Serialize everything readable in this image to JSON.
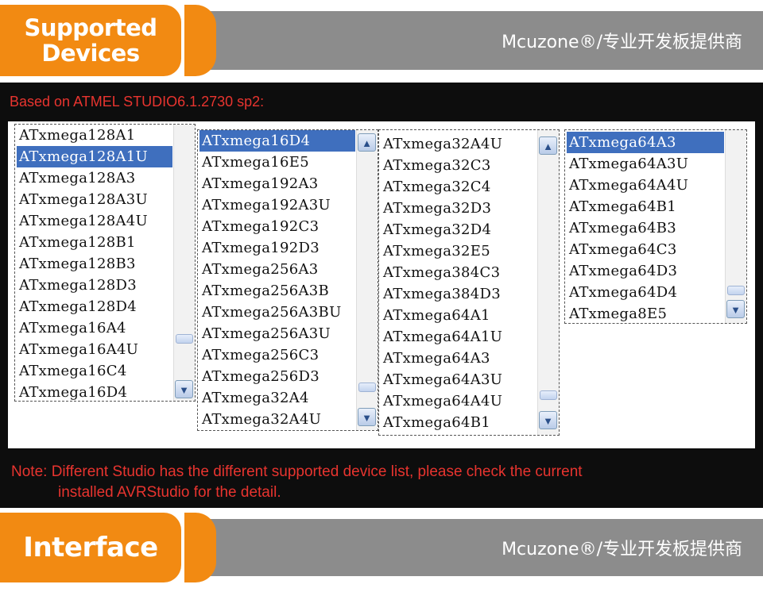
{
  "header_top": {
    "title": "Supported\nDevices",
    "brand": "Mcuzone®/专业开发板提供商"
  },
  "based_on": "Based on ATMEL STUDIO6.1.2730 sp2:",
  "lists": [
    {
      "items": [
        "ATxmega128A1",
        "ATxmega128A1U",
        "ATxmega128A3",
        "ATxmega128A3U",
        "ATxmega128A4U",
        "ATxmega128B1",
        "ATxmega128B3",
        "ATxmega128D3",
        "ATxmega128D4",
        "ATxmega16A4",
        "ATxmega16A4U",
        "ATxmega16C4",
        "ATxmega16D4"
      ],
      "selected": "ATxmega128A1U"
    },
    {
      "items": [
        "ATxmega16D4",
        "ATxmega16E5",
        "ATxmega192A3",
        "ATxmega192A3U",
        "ATxmega192C3",
        "ATxmega192D3",
        "ATxmega256A3",
        "ATxmega256A3B",
        "ATxmega256A3BU",
        "ATxmega256A3U",
        "ATxmega256C3",
        "ATxmega256D3",
        "ATxmega32A4",
        "ATxmega32A4U"
      ],
      "selected": "ATxmega16D4"
    },
    {
      "items": [
        "ATxmega32A4U",
        "ATxmega32C3",
        "ATxmega32C4",
        "ATxmega32D3",
        "ATxmega32D4",
        "ATxmega32E5",
        "ATxmega384C3",
        "ATxmega384D3",
        "ATxmega64A1",
        "ATxmega64A1U",
        "ATxmega64A3",
        "ATxmega64A3U",
        "ATxmega64A4U",
        "ATxmega64B1"
      ],
      "selected": ""
    },
    {
      "items": [
        "ATxmega64A3",
        "ATxmega64A3U",
        "ATxmega64A4U",
        "ATxmega64B1",
        "ATxmega64B3",
        "ATxmega64C3",
        "ATxmega64D3",
        "ATxmega64D4",
        "ATxmega8E5"
      ],
      "selected": "ATxmega64A3"
    }
  ],
  "note": {
    "line1": "Note: Different Studio has the different supported device list, please check the current",
    "line2": "installed AVRStudio for the detail."
  },
  "header_bottom": {
    "title": "Interface",
    "brand": "Mcuzone®/专业开发板提供商"
  },
  "colors": {
    "accent": "#f28a12",
    "banner_gray": "#8c8c8c",
    "note_red": "#e8342f",
    "selection": "#3f6fbe"
  },
  "icons": {
    "up": "scroll-up-arrow-icon",
    "down": "scroll-down-arrow-icon"
  }
}
